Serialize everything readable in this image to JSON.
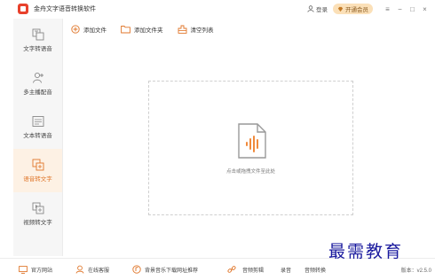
{
  "app": {
    "title": "金舟文字语音转换软件"
  },
  "titlebar": {
    "login_label": "登录",
    "vip_label": "开通会员",
    "menu": "≡",
    "minimize": "−",
    "maximize": "□",
    "close": "×"
  },
  "sidebar": {
    "items": [
      {
        "label": "文字转语音",
        "icon": "text-to-speech-icon",
        "active": false
      },
      {
        "label": "多主播配音",
        "icon": "multi-speaker-icon",
        "active": false
      },
      {
        "label": "文本转语音",
        "icon": "document-to-speech-icon",
        "active": false
      },
      {
        "label": "语音转文字",
        "icon": "speech-to-text-icon",
        "active": true
      },
      {
        "label": "视频转文字",
        "icon": "video-to-text-icon",
        "active": false
      }
    ]
  },
  "toolbar": {
    "add_file": "添加文件",
    "add_folder": "添加文件夹",
    "clear_list": "清空列表"
  },
  "dropzone": {
    "hint": "点击或拖拽文件至此处"
  },
  "footer": {
    "website": "官方网站",
    "support": "在线客服",
    "bgm": "背景音乐下载网址推荐",
    "audio_cut": "音频剪辑",
    "record": "录音",
    "audio_convert": "音频转换",
    "version": "版本：v2.5.0"
  },
  "watermark": "最需教育",
  "colors": {
    "accent": "#e0762a",
    "logo": "#e8412c",
    "vip_bg": "#fbe0b8",
    "watermark": "#1a1a9e"
  }
}
